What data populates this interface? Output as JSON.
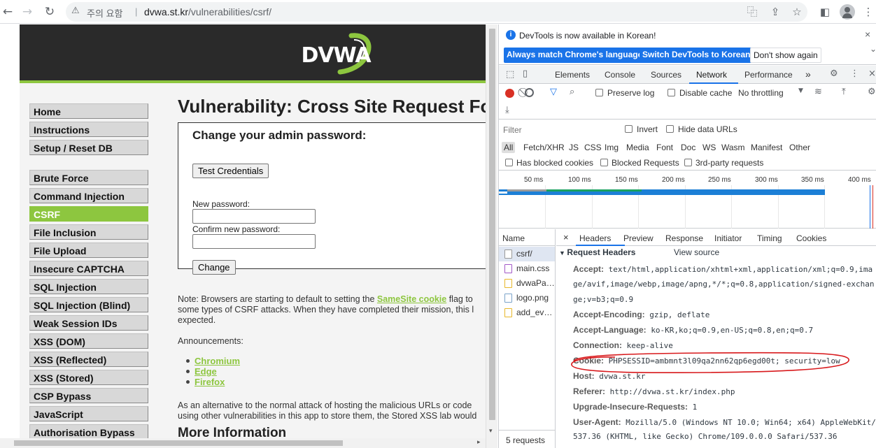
{
  "browser": {
    "back_icon": "arrow-left-icon",
    "security_label": "주의 요함",
    "separator": "|",
    "url_host": "dvwa.st.kr",
    "url_path": "/vulnerabilities/csrf/"
  },
  "dvwa": {
    "logo": "DVWA",
    "menu_group1": [
      "Home",
      "Instructions",
      "Setup / Reset DB"
    ],
    "menu_group2": [
      "Brute Force",
      "Command Injection",
      "CSRF",
      "File Inclusion",
      "File Upload",
      "Insecure CAPTCHA",
      "SQL Injection",
      "SQL Injection (Blind)",
      "Weak Session IDs",
      "XSS (DOM)",
      "XSS (Reflected)",
      "XSS (Stored)",
      "CSP Bypass",
      "JavaScript",
      "Authorisation Bypass"
    ],
    "active_item": "CSRF",
    "title": "Vulnerability: Cross Site Request Fo",
    "form": {
      "heading": "Change your admin password:",
      "test_button": "Test Credentials",
      "new_password_label": "New password:",
      "confirm_password_label": "Confirm new password:",
      "change_button": "Change"
    },
    "note_line1_pre": "Note: Browsers are starting to default to setting the ",
    "note_link": "SameSite cookie",
    "note_line1_post": " flag to",
    "note_line2": "some types of CSRF attacks. When they have completed their mission, this l",
    "note_line3": "expected.",
    "announcements_label": "Announcements:",
    "announcements": [
      "Chromium",
      "Edge",
      "Firefox"
    ],
    "alt_line1": "As an alternative to the normal attack of hosting the malicious URLs or code",
    "alt_line2": "using other vulnerabilities in this app to store them, the Stored XSS lab would",
    "more_info": "More Information"
  },
  "devtools": {
    "info_message": "DevTools is now available in Korean!",
    "btn_match": "Always match Chrome's language",
    "btn_switch": "Switch DevTools to Korean",
    "btn_dont_show": "Don't show again",
    "tabs": [
      "Elements",
      "Console",
      "Sources",
      "Network",
      "Performance"
    ],
    "active_tab": "Network",
    "more_tabs": "»",
    "preserve_log": "Preserve log",
    "disable_cache": "Disable cache",
    "throttling": "No throttling",
    "filter_placeholder": "Filter",
    "invert": "Invert",
    "hide_data_urls": "Hide data URLs",
    "types": [
      "All",
      "Fetch/XHR",
      "JS",
      "CSS",
      "Img",
      "Media",
      "Font",
      "Doc",
      "WS",
      "Wasm",
      "Manifest",
      "Other"
    ],
    "has_blocked_cookies": "Has blocked cookies",
    "blocked_requests": "Blocked Requests",
    "third_party": "3rd-party requests",
    "ticks": [
      "50 ms",
      "100 ms",
      "150 ms",
      "200 ms",
      "250 ms",
      "300 ms",
      "350 ms",
      "400 ms"
    ],
    "name_header": "Name",
    "requests": [
      "csrf/",
      "main.css",
      "dvwaPa…",
      "logo.png",
      "add_ev…"
    ],
    "request_count": "5 requests",
    "detail_tabs": [
      "Headers",
      "Preview",
      "Response",
      "Initiator",
      "Timing",
      "Cookies"
    ],
    "request_headers_title": "Request Headers",
    "view_source": "View source",
    "headers": {
      "accept_key": "Accept:",
      "accept_v1": "text/html,application/xhtml+xml,application/xml;q=0.9,ima",
      "accept_v2": "ge/avif,image/webp,image/apng,*/*;q=0.8,application/signed-exchan",
      "accept_v3": "ge;v=b3;q=0.9",
      "encoding_key": "Accept-Encoding:",
      "encoding_val": "gzip, deflate",
      "language_key": "Accept-Language:",
      "language_val": "ko-KR,ko;q=0.9,en-US;q=0.8,en;q=0.7",
      "connection_key": "Connection:",
      "connection_val": "keep-alive",
      "cookie_key": "Cookie:",
      "cookie_val": "PHPSESSID=ambmnt3l09qa2nn62qp6egd00t; security=low",
      "host_key": "Host:",
      "host_val": "dvwa.st.kr",
      "referer_key": "Referer:",
      "referer_val": "http://dvwa.st.kr/index.php",
      "upgrade_key": "Upgrade-Insecure-Requests:",
      "upgrade_val": "1",
      "ua_key": "User-Agent:",
      "ua_v1": "Mozilla/5.0 (Windows NT 10.0; Win64; x64) AppleWebKit/",
      "ua_v2": "537.36 (KHTML, like Gecko) Chrome/109.0.0.0 Safari/537.36"
    }
  },
  "colors": {
    "dvwa_green": "#8dc63f",
    "devtools_blue": "#1a73e8",
    "annotation_red": "#d8191c"
  }
}
